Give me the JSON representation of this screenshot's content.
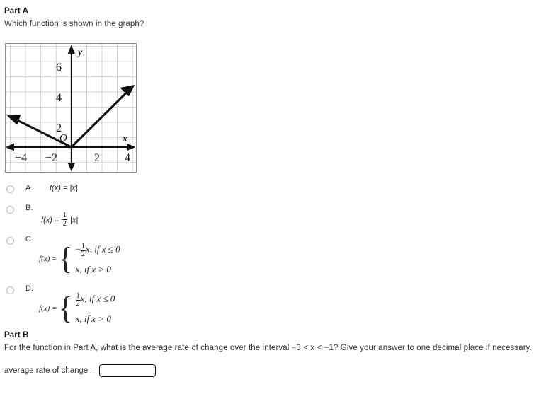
{
  "part_a": {
    "heading": "Part A",
    "prompt": "Which function is shown in the graph?"
  },
  "part_b": {
    "heading": "Part B",
    "prompt": "For the function in Part A, what is the average rate of change over the interval −3 < x < −1? Give your answer to one decimal place if necessary."
  },
  "answer": {
    "label": "average rate of change =",
    "value": "",
    "placeholder": ""
  },
  "options": [
    {
      "letter": "A.",
      "kind": "simple",
      "lhs": "f(x) =",
      "rhs": "|x|",
      "selected": false
    },
    {
      "letter": "B.",
      "kind": "fraction",
      "lhs": "f(x) =",
      "numerator": "1",
      "denominator": "2",
      "rhs": "|x|",
      "selected": false
    },
    {
      "letter": "C.",
      "kind": "piecewise",
      "lhs": "f(x) =",
      "case1_sign": "−",
      "case1_num": "1",
      "case1_den": "2",
      "case1_var": "x",
      "case1_cond": ", if x ≤ 0",
      "case2": "x, if x > 0",
      "selected": false
    },
    {
      "letter": "D.",
      "kind": "piecewise",
      "lhs": "f(x) =",
      "case1_sign": "",
      "case1_num": "1",
      "case1_den": "2",
      "case1_var": "x",
      "case1_cond": ", if x ≤ 0",
      "case2": "x, if x > 0",
      "selected": false
    }
  ],
  "chart_data": {
    "type": "line",
    "title": "",
    "xlabel": "x",
    "ylabel": "y",
    "xlim": [
      -5,
      5
    ],
    "ylim": [
      -1.6,
      7.4
    ],
    "xticks": [
      -4,
      -2,
      2,
      4
    ],
    "yticks": [
      2,
      4,
      6
    ],
    "origin_label": "O",
    "grid": true,
    "grid_step": 1,
    "series": [
      {
        "name": "left-ray",
        "comment": "f(x) = -1/2 x for x <= 0, ray from origin to upper-left with arrowhead",
        "points": [
          [
            0,
            0
          ],
          [
            -4.2,
            2.1
          ]
        ],
        "slope": -0.5
      },
      {
        "name": "right-ray",
        "comment": "f(x) = x for x > 0, ray from origin up-right with arrowhead",
        "points": [
          [
            0,
            0
          ],
          [
            4.1,
            4.1
          ]
        ],
        "slope": 1
      }
    ]
  }
}
